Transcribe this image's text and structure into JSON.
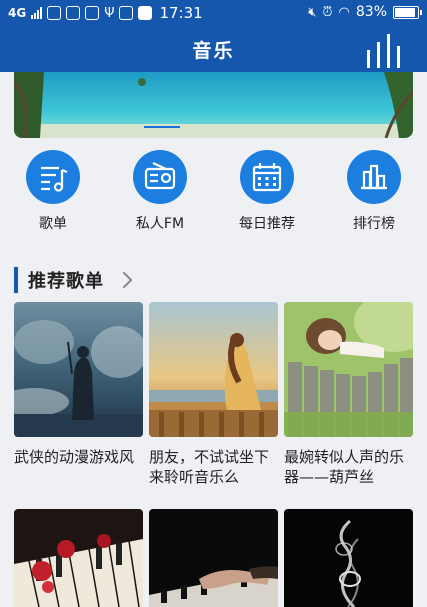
{
  "statusbar": {
    "network": "4G",
    "time": "17:31",
    "battery": "83%",
    "battery_level": 0.83
  },
  "header": {
    "title": "音乐"
  },
  "quicknav": [
    {
      "label": "歌单",
      "icon": "playlist-icon"
    },
    {
      "label": "私人FM",
      "icon": "radio-icon"
    },
    {
      "label": "每日推荐",
      "icon": "calendar-icon"
    },
    {
      "label": "排行榜",
      "icon": "chart-icon"
    }
  ],
  "section": {
    "title": "推荐歌单"
  },
  "playlists": [
    {
      "title": "武侠的动漫游戏风"
    },
    {
      "title": "朋友，不试试坐下来聆听音乐么"
    },
    {
      "title": "最婉转似人声的乐器——葫芦丝"
    }
  ],
  "colors": {
    "primary": "#1457ad",
    "accent": "#1c7fe0",
    "background": "#eef0f4"
  }
}
